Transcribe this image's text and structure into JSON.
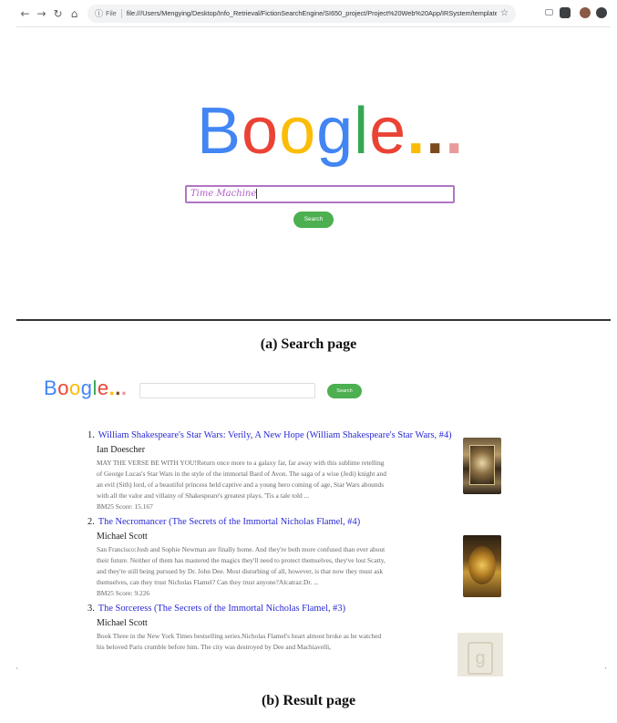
{
  "browser": {
    "file_label": "File",
    "url": "file:///Users/Mengying/Desktop/Info_Retrieval/FictionSearchEngine/SI650_project/Project%20Web%20App/IRSystem/templates/index..."
  },
  "search_page": {
    "logo_letters": [
      "B",
      "o",
      "o",
      "g",
      "l",
      "e"
    ],
    "logo_dots": "...",
    "query": "Time Machine",
    "button_label": "Search"
  },
  "result_page": {
    "logo_letters": [
      "B",
      "o",
      "o",
      "g",
      "l",
      "e"
    ],
    "logo_dots": "...",
    "button_label": "Search",
    "results": [
      {
        "num": "1.",
        "title": "William Shakespeare's Star Wars: Verily, A New Hope (William Shakespeare's Star Wars, #4)",
        "author": "Ian Doescher",
        "description": "MAY THE VERSE BE WITH YOU!Return once more to a galaxy far, far away with this sublime retelling of George Lucas's Star Wars in the style of the immortal Bard of Avon. The saga of a wise (Jedi) knight and an evil (Sith) lord, of a beautiful princess held captive and a young hero coming of age, Star Wars abounds with all the valor and villainy of Shakespeare's greatest plays. 'Tis a tale told ...",
        "score": "BM25 Score: 15.167"
      },
      {
        "num": "2.",
        "title": "The Necromancer (The Secrets of the Immortal Nicholas Flamel, #4)",
        "author": "Michael Scott",
        "description": "San Francisco:Josh and Sophie Newman are finally home. And they're both more confused than ever about their future. Neither of them has mastered the magics they'll need to protect themselves, they've lost Scatty, and they're still being pursued by Dr. John Dee. Most disturbing of all, however, is that now they must ask themselves, can they trust Nicholas Flamel? Can they trust anyone?Alcatraz:Dr. ...",
        "score": "BM25 Score: 9.226"
      },
      {
        "num": "3.",
        "title": "The Sorceress (The Secrets of the Immortal Nicholas Flamel, #3)",
        "author": "Michael Scott",
        "description": "Book Three in the New York Times bestselling series.Nicholas Flamel's heart almost broke as he watched his beloved Paris crumble before him. The city was destroyed by Dee and Machiavelli,",
        "score": ""
      }
    ]
  },
  "captions": {
    "a": "(a) Search page",
    "b": "(b) Result page"
  },
  "colors": {
    "logo_blue": "#4285f4",
    "logo_red": "#ea4335",
    "logo_yellow": "#fbbc05",
    "logo_green": "#34a853",
    "link": "#2a2ad6",
    "button": "#4caf50",
    "search_border": "#b076c4"
  },
  "icons": [
    "back-icon",
    "forward-icon",
    "reload-icon",
    "home-icon",
    "info-icon",
    "star-icon",
    "extension-icon",
    "profile-icon"
  ]
}
